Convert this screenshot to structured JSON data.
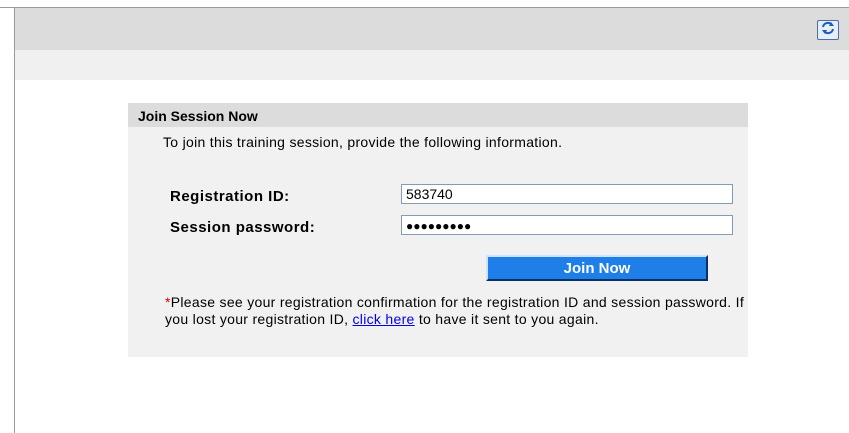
{
  "toolbar": {
    "refresh_icon": "refresh-icon"
  },
  "panel": {
    "title": "Join Session Now",
    "intro": "To join this training session, provide the following information."
  },
  "form": {
    "registration_label": "Registration ID:",
    "registration_value": "583740",
    "password_label": "Session password:",
    "password_value": "●●●●●●●●●",
    "join_button": "Join Now"
  },
  "note": {
    "asterisk": "*",
    "text_before": "Please see your registration confirmation for the registration ID and session password. If you lost your registration ID, ",
    "link_text": "click here",
    "text_after": " to have it sent to you again."
  },
  "colors": {
    "header_bar": "#dcdcdc",
    "panel_bg": "#f1f1f1",
    "button_bg": "#1f7fe8",
    "link": "#0000ee",
    "asterisk": "#e00000"
  }
}
